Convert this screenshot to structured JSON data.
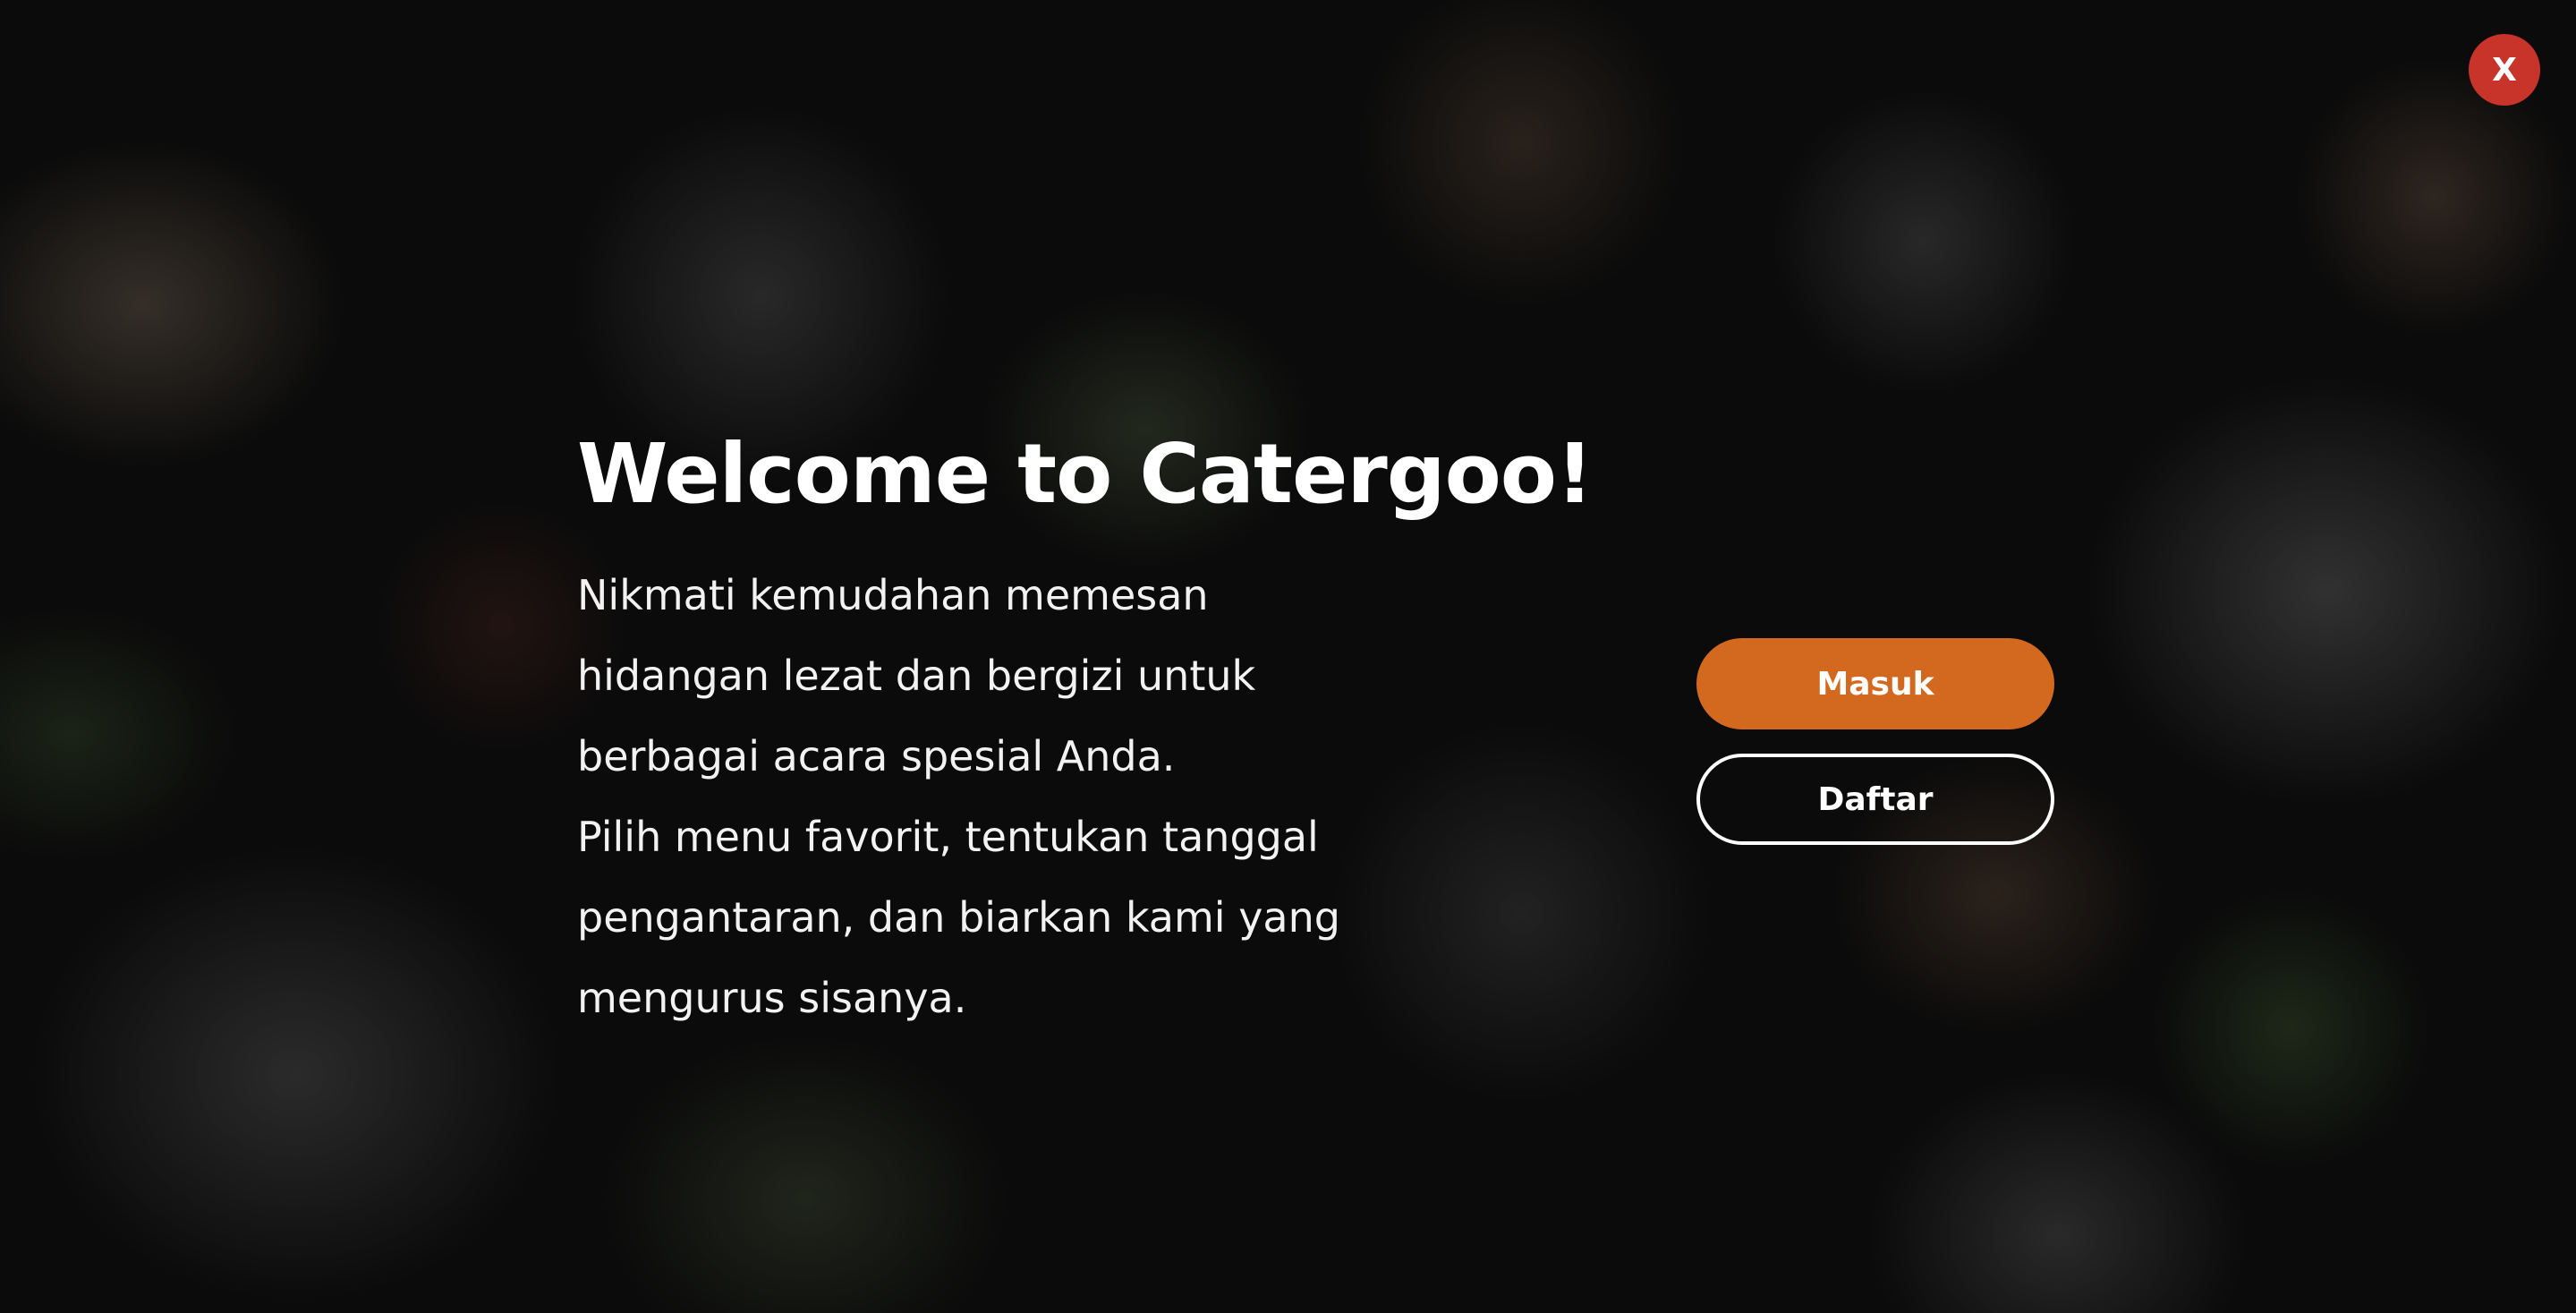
{
  "modal": {
    "title": "Welcome to Catergoo!",
    "description": [
      "Nikmati kemudahan memesan hidangan lezat dan bergizi untuk berbagai acara spesial Anda.",
      "Pilih menu favorit, tentukan tanggal pengantaran, dan biarkan kami yang mengurus sisanya."
    ],
    "close_label": "X",
    "login_label": "Masuk",
    "register_label": "Daftar"
  },
  "colors": {
    "accent": "#d2691e",
    "close_button": "#c8342a",
    "text": "#ffffff"
  },
  "icons": {
    "close": "close-icon"
  }
}
